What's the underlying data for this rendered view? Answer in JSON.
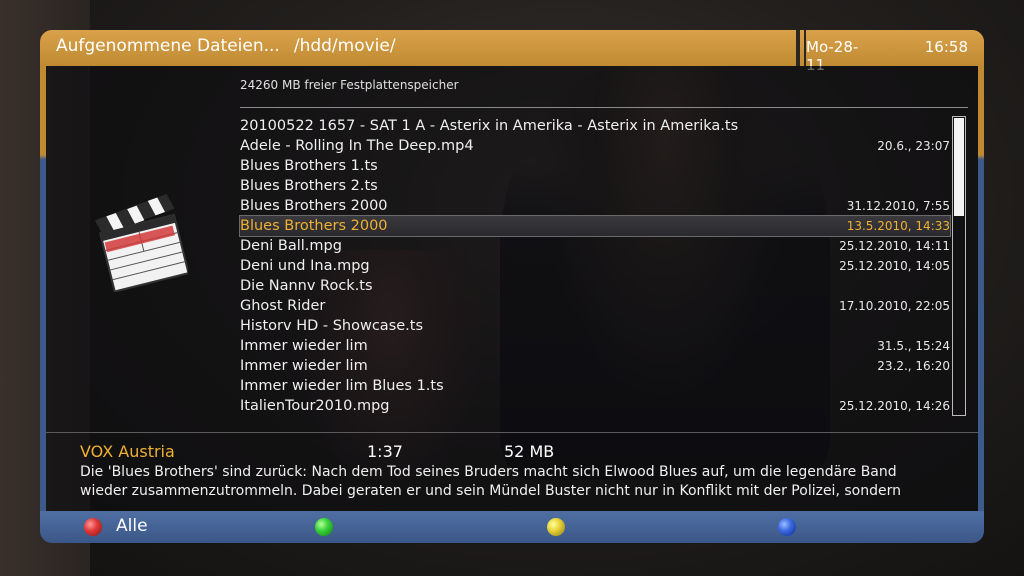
{
  "header": {
    "title": "Aufgenommene Dateien...",
    "path": "/hdd/movie/",
    "date": "Mo-28-11",
    "time": "16:58"
  },
  "free_space": "24260 MB freier Festplattenspeicher",
  "files": [
    {
      "name": "20100522 1657 - SAT  1 A - Asterix in Amerika - Asterix in Amerika.ts",
      "date": ""
    },
    {
      "name": "Adele - Rolling In The Deep.mp4",
      "date": "20.6., 23:07"
    },
    {
      "name": "Blues Brothers 1.ts",
      "date": ""
    },
    {
      "name": "Blues Brothers 2.ts",
      "date": ""
    },
    {
      "name": "Blues Brothers 2000",
      "date": "31.12.2010, 7:55"
    },
    {
      "name": "Blues Brothers 2000",
      "date": "13.5.2010, 14:33",
      "selected": true
    },
    {
      "name": "Deni  Ball.mpg",
      "date": "25.12.2010, 14:11"
    },
    {
      "name": "Deni  und  Ina.mpg",
      "date": "25.12.2010, 14:05"
    },
    {
      "name": "Die Nannv Rock.ts",
      "date": ""
    },
    {
      "name": "Ghost Rider",
      "date": "17.10.2010, 22:05"
    },
    {
      "name": "Historv HD - Showcase.ts",
      "date": ""
    },
    {
      "name": "Immer wieder lim",
      "date": "31.5., 15:24"
    },
    {
      "name": "Immer wieder lim",
      "date": "23.2., 16:20"
    },
    {
      "name": "Immer wieder lim Blues 1.ts",
      "date": ""
    },
    {
      "name": "ItalienTour2010.mpg",
      "date": "25.12.2010, 14:26"
    }
  ],
  "info": {
    "channel": "VOX Austria",
    "duration": "1:37",
    "size": "52 MB",
    "description_lines": [
      "Die 'Blues Brothers' sind zurück: Nach dem Tod seines Bruders macht sich Elwood Blues auf, um die legendäre Band",
      "wieder zusammenzutrommeln. Dabei geraten er und sein Mündel Buster nicht nur in Konflikt mit der Polizei, sondern"
    ]
  },
  "footer": {
    "red_label": "Alle"
  },
  "icons": {
    "movie": "clapperboard-icon",
    "red": "red-button-icon",
    "green": "green-button-icon",
    "yellow": "yellow-button-icon",
    "blue": "blue-button-icon"
  },
  "colors": {
    "header": "#c89238",
    "footer": "#4666a0",
    "selected_text": "#f0b030"
  }
}
